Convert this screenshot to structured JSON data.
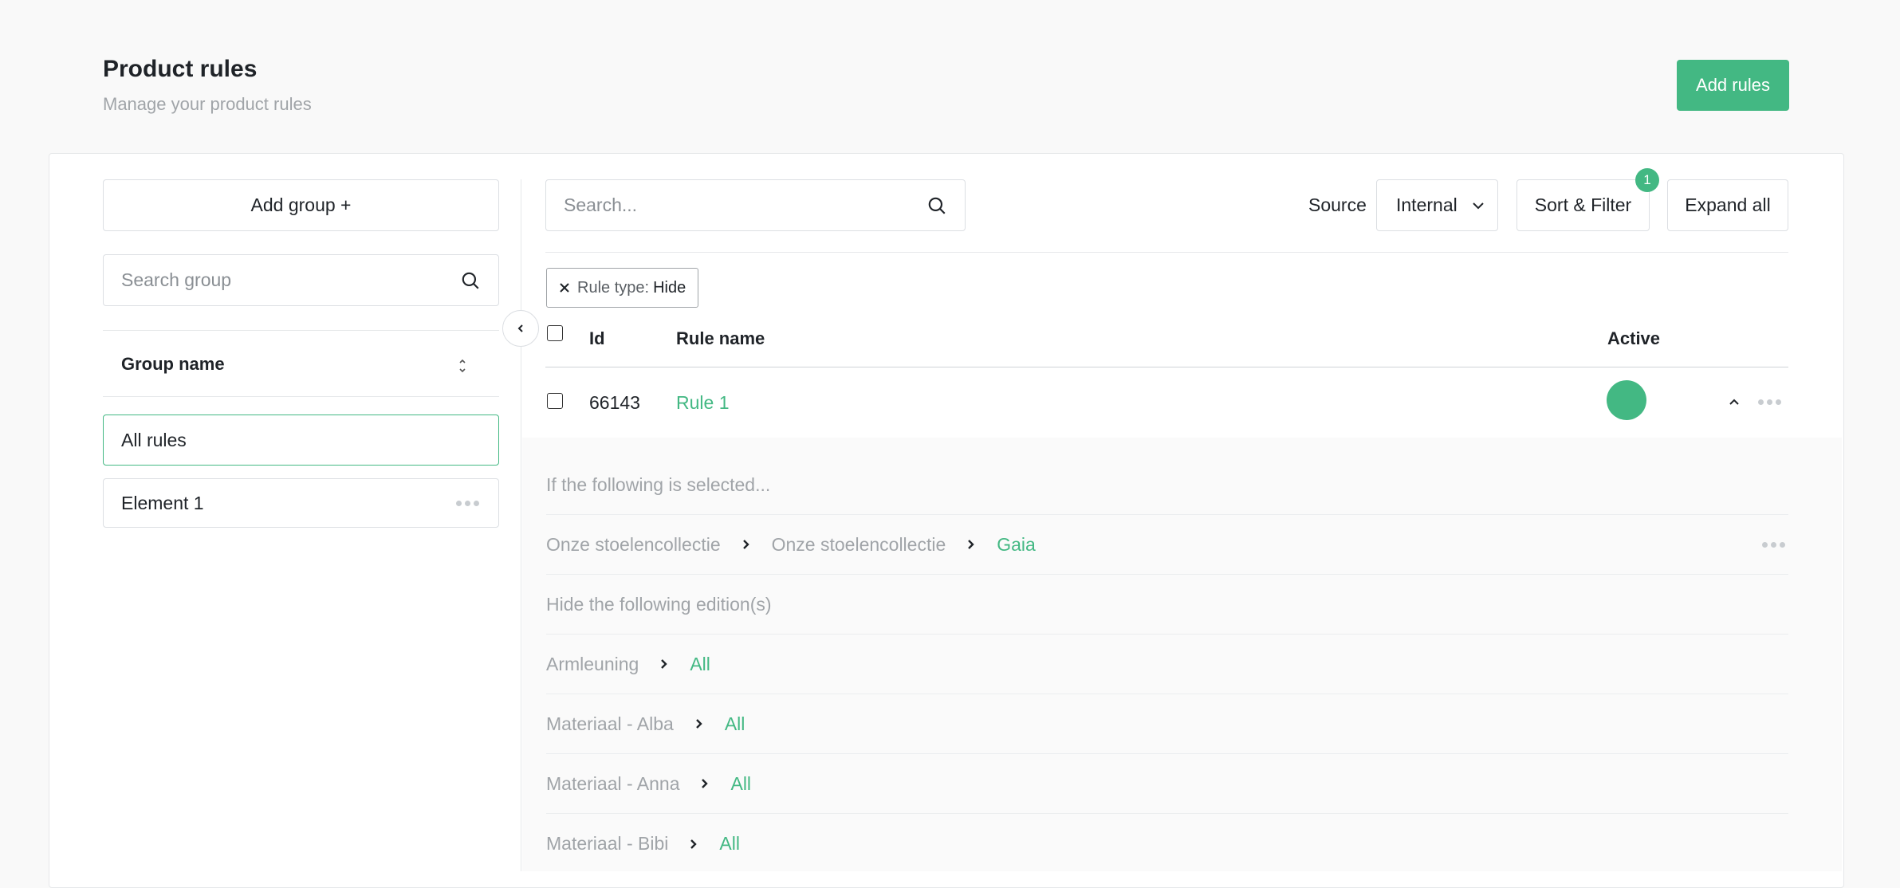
{
  "header": {
    "title": "Product rules",
    "subtitle": "Manage your product rules",
    "add_rules_label": "Add rules"
  },
  "sidebar": {
    "add_group_label": "Add group +",
    "search_placeholder": "Search group",
    "group_name_header": "Group name",
    "items": [
      {
        "label": "All rules",
        "selected": true
      },
      {
        "label": "Element 1",
        "selected": false
      }
    ]
  },
  "toolbar": {
    "search_placeholder": "Search...",
    "source_label": "Source",
    "source_value": "Internal",
    "sort_filter_label": "Sort & Filter",
    "filter_count": "1",
    "expand_all_label": "Expand all"
  },
  "active_filter": {
    "key": "Rule type:",
    "value": "Hide"
  },
  "table": {
    "columns": {
      "id": "Id",
      "rule_name": "Rule name",
      "active": "Active"
    },
    "rows": [
      {
        "id": "66143",
        "rule_name": "Rule 1",
        "active": true
      }
    ]
  },
  "rule_detail": {
    "condition_heading": "If the following is selected...",
    "condition_path": [
      "Onze stoelencollectie",
      "Onze stoelencollectie",
      "Gaia"
    ],
    "action_heading": "Hide the following edition(s)",
    "editions": [
      {
        "label": "Armleuning",
        "value": "All"
      },
      {
        "label": "Materiaal - Alba",
        "value": "All"
      },
      {
        "label": "Materiaal - Anna",
        "value": "All"
      },
      {
        "label": "Materiaal - Bibi",
        "value": "All"
      }
    ]
  },
  "colors": {
    "accent": "#43b883",
    "muted_text": "#a0a4a8",
    "border": "#dcdfe3"
  }
}
